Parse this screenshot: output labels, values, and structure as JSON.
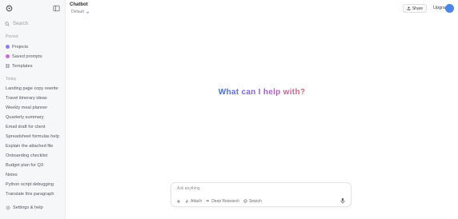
{
  "sidebar": {
    "search_label": "Search",
    "section_pinned": "Pinned",
    "pinned": [
      {
        "label": "Projects",
        "color": "#8b7cf6"
      },
      {
        "label": "Saved prompts",
        "color": "#c86ad8"
      },
      {
        "label": "Templates",
        "color": "#9a9aa3"
      }
    ],
    "section_recent": "Today",
    "recent": [
      "Landing page copy rewrite",
      "Travel itinerary ideas",
      "Weekly meal planner",
      "Quarterly summary",
      "Email draft for client",
      "Spreadsheet formulas help",
      "Explain the attached file",
      "Onboarding checklist",
      "Budget plan for Q3",
      "Notes",
      "Python script debugging",
      "Translate this paragraph"
    ],
    "footer_label": "Settings & help"
  },
  "header": {
    "title": "Chatbot",
    "model_label": "Default"
  },
  "toolbar": {
    "share_label": "Share",
    "user_label": "Upgrade"
  },
  "main": {
    "greeting": "What can I help with?"
  },
  "composer": {
    "placeholder": "Ask anything",
    "chips": [
      "Attach",
      "Deep Research",
      "Search"
    ]
  },
  "colors": {
    "accent": "#4a86e8",
    "greeting_gradient": [
      "#3d6fe0",
      "#a05bd8",
      "#e06a6a"
    ]
  }
}
